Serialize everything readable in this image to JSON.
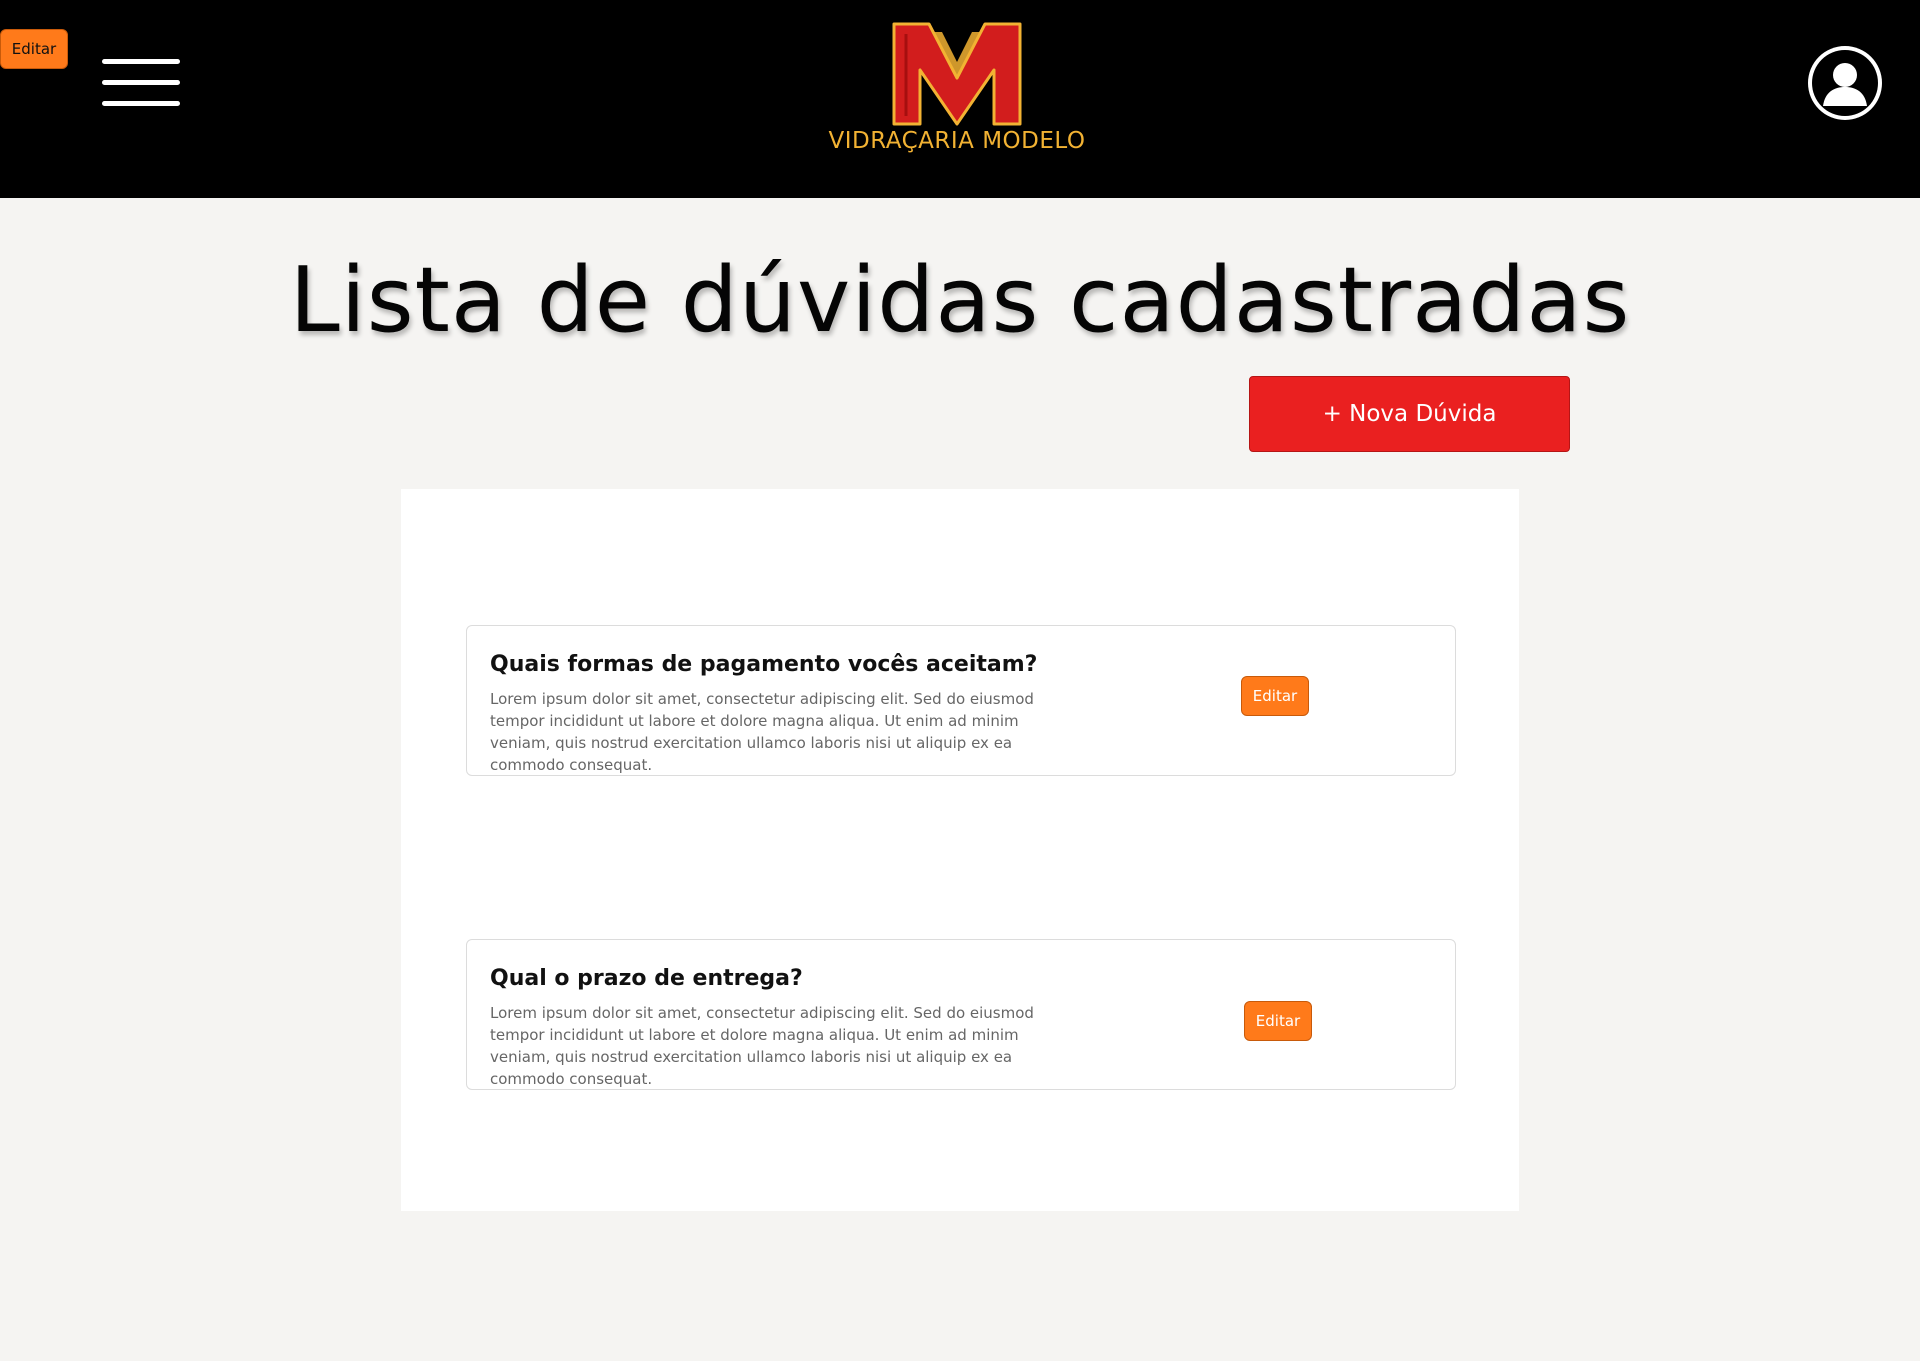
{
  "header": {
    "edit_label": "Editar",
    "brand_name": "VIDRAÇARIA MODELO",
    "menu_icon": "hamburger-menu-icon",
    "avatar_icon": "user-avatar-icon"
  },
  "page": {
    "title": "Lista de dúvidas cadastradas",
    "new_button_label": "+ Nova Dúvida"
  },
  "faqs": [
    {
      "question": "Quais formas de pagamento vocês aceitam?",
      "answer": "Lorem ipsum dolor sit amet, consectetur adipiscing elit. Sed do eiusmod tempor incididunt ut labore et dolore magna aliqua. Ut enim ad minim veniam, quis nostrud exercitation ullamco laboris nisi ut aliquip ex ea commodo consequat.",
      "edit_label": "Editar"
    },
    {
      "question": "Qual o prazo de entrega?",
      "answer": "Lorem ipsum dolor sit amet, consectetur adipiscing elit. Sed do eiusmod tempor incididunt ut labore et dolore magna aliqua. Ut enim ad minim veniam, quis nostrud exercitation ullamco laboris nisi ut aliquip ex ea commodo consequat.",
      "edit_label": "Editar"
    }
  ],
  "colors": {
    "header_bg": "#000000",
    "accent_red": "#ea2020",
    "accent_orange": "#ff7a1a",
    "brand_gold": "#f2b233"
  }
}
